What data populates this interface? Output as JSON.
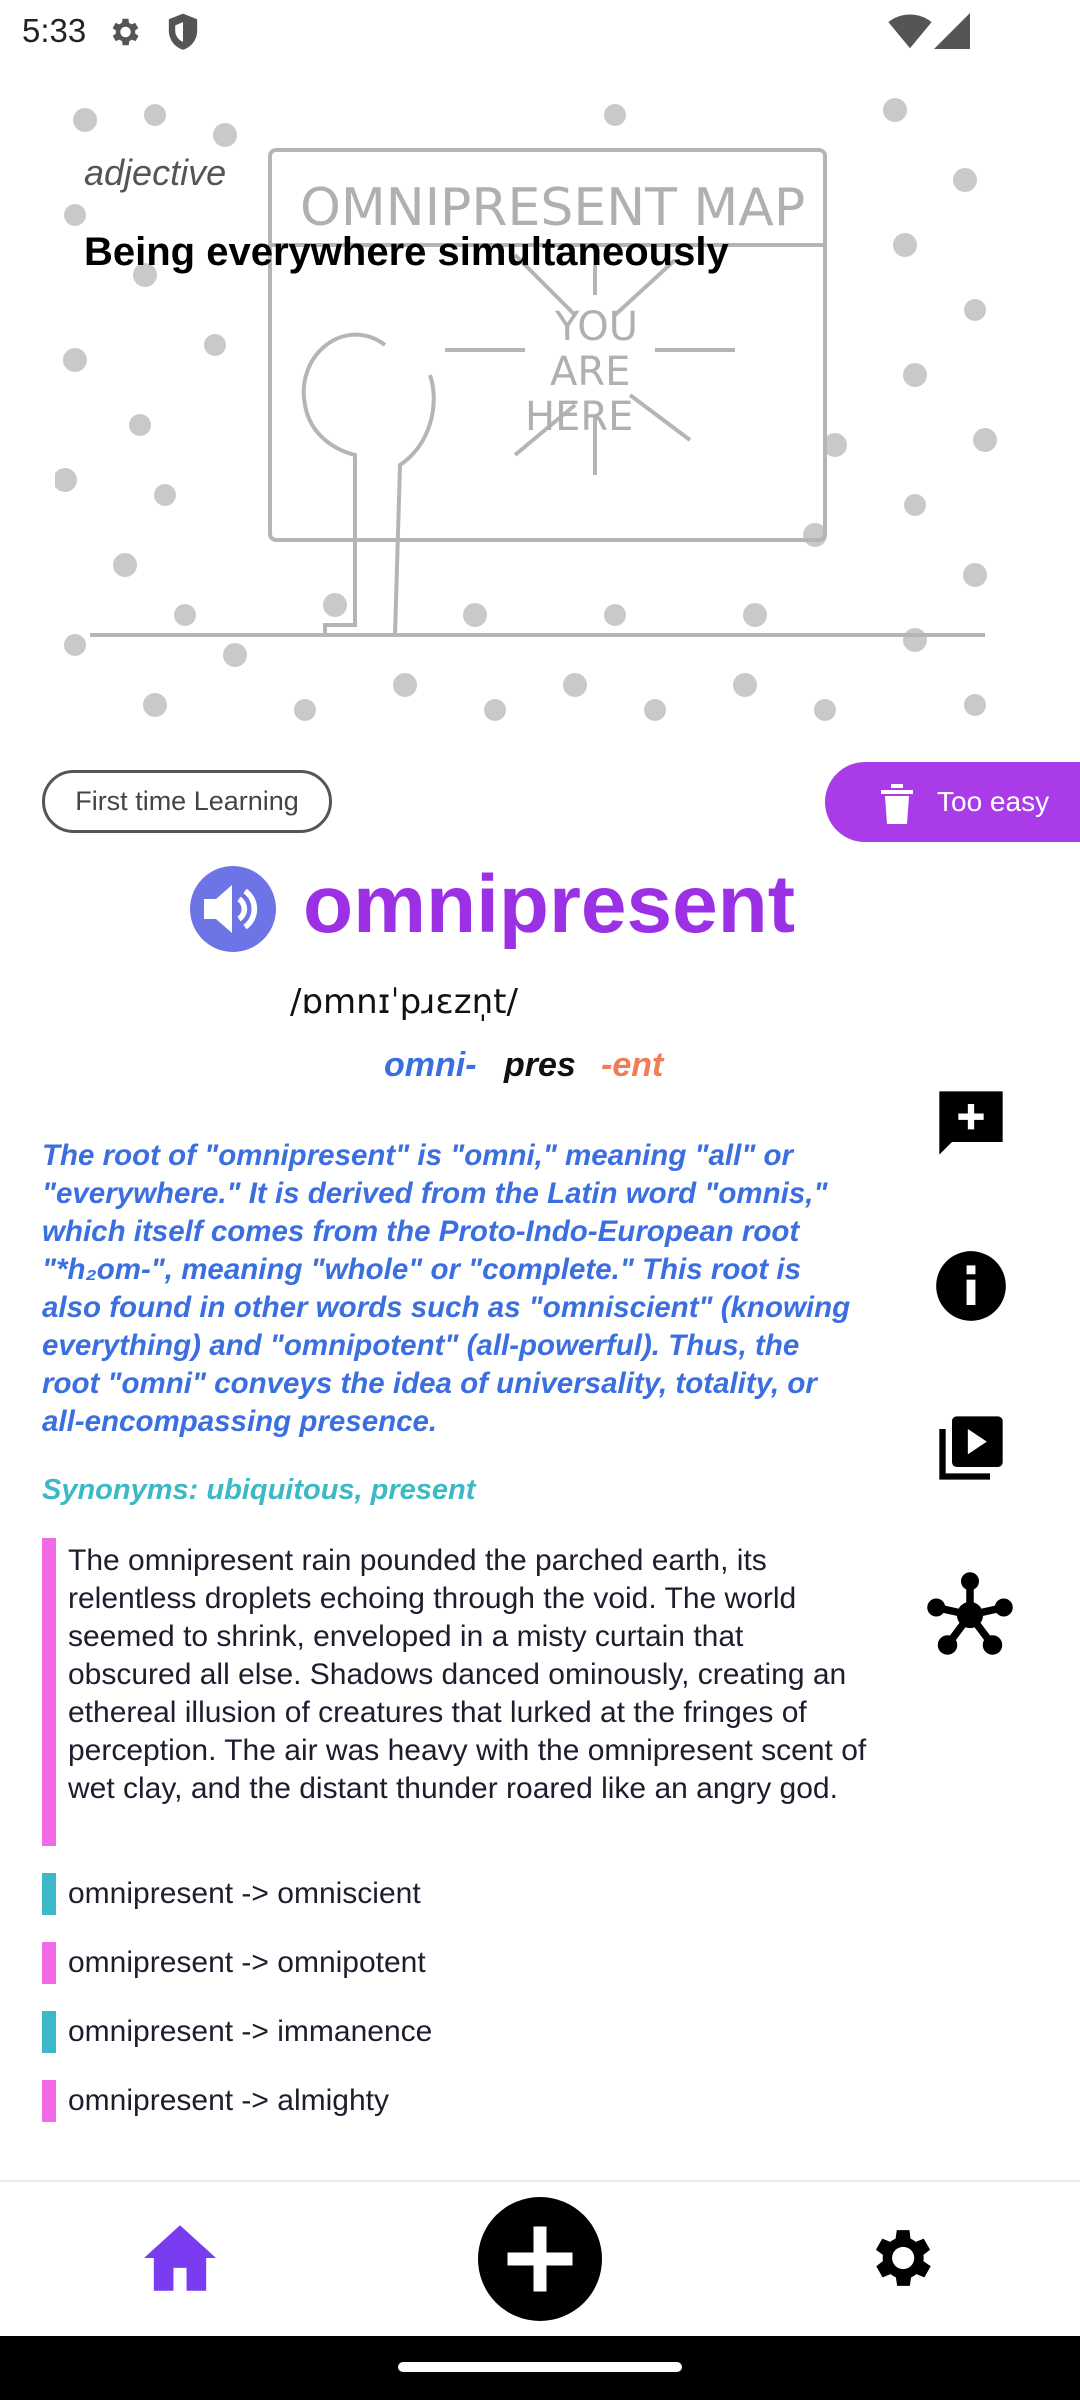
{
  "status_bar": {
    "time": "5:33",
    "icons": [
      "gear-icon",
      "shield-icon",
      "wifi-icon",
      "signal-icon"
    ]
  },
  "card": {
    "illustration_text": [
      "OMNIPRESENT MAP",
      "YOU",
      "ARE",
      "HERE"
    ],
    "part_of_speech": "adjective",
    "definition": "Being everywhere simultaneously"
  },
  "learning": {
    "status_label": "First time Learning",
    "too_easy_label": "Too easy"
  },
  "word": {
    "text": "omnipresent",
    "phonetic": "/ɒmnɪˈpɹɛzn̩t/",
    "morphemes": [
      "omni-",
      "pres",
      "-ent"
    ]
  },
  "etymology": "The root of \"omnipresent\" is \"omni,\" meaning \"all\" or \"everywhere.\" It is derived from the Latin word \"omnis,\" which itself comes from the Proto-Indo-European root \"*h₂om-\", meaning \"whole\" or \"complete.\" This root is also found in other words such as \"omniscient\" (knowing everything) and \"omnipotent\" (all-powerful). Thus, the root \"omni\" conveys the idea of universality, totality, or all-encompassing presence.",
  "synonyms": "Synonyms: ubiquitous, present",
  "example": "The omnipresent rain pounded the parched earth, its relentless droplets echoing through the void. The world seemed to shrink, enveloped in a misty curtain that obscured all else. Shadows danced ominously, creating an ethereal illusion of creatures that lurked at the fringes of perception. The air was heavy with the omnipresent scent of wet clay, and the distant thunder roared like an angry god.",
  "related": [
    {
      "text": "omnipresent -> omniscient",
      "color": "#3bb9c6"
    },
    {
      "text": "omnipresent -> omnipotent",
      "color": "#f269e6"
    },
    {
      "text": "omnipresent -> immanence",
      "color": "#3bb9c6"
    },
    {
      "text": "omnipresent -> almighty",
      "color": "#f269e6"
    }
  ],
  "side_actions": [
    "add-comment-icon",
    "info-icon",
    "video-library-icon",
    "network-icon"
  ],
  "nav": {
    "items": [
      "home-icon",
      "add-icon",
      "settings-icon"
    ],
    "active_color": "#7a3cf0"
  },
  "colors": {
    "accent": "#9b30e5",
    "too_easy": "#a93ce8",
    "etymology": "#3b6fe0",
    "synonyms": "#3bb9c6",
    "example_bar": "#f269e6",
    "suffix": "#f07d55"
  }
}
